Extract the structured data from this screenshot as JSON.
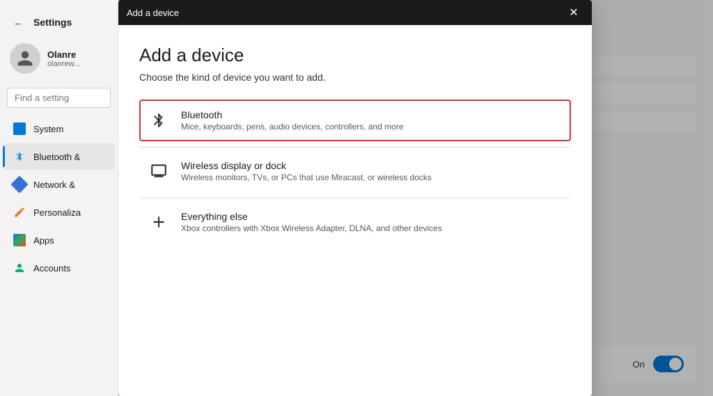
{
  "sidebar": {
    "back_label": "←",
    "title": "Settings",
    "user": {
      "name": "Olanre",
      "email": "olanrew..."
    },
    "search_placeholder": "Find a setting",
    "nav_items": [
      {
        "id": "system",
        "label": "System",
        "icon": "system-icon"
      },
      {
        "id": "bluetooth",
        "label": "Bluetooth &",
        "icon": "bluetooth-icon",
        "active": true
      },
      {
        "id": "network",
        "label": "Network &",
        "icon": "network-icon"
      },
      {
        "id": "personalization",
        "label": "Personaliza",
        "icon": "personalize-icon"
      },
      {
        "id": "apps",
        "label": "Apps",
        "icon": "apps-icon"
      },
      {
        "id": "accounts",
        "label": "Accounts",
        "icon": "accounts-icon"
      }
    ]
  },
  "background_panel": {
    "toggle_label": "On"
  },
  "modal": {
    "titlebar_title": "Add a device",
    "close_label": "✕",
    "heading": "Add a device",
    "subtitle": "Choose the kind of device you want to add.",
    "options": [
      {
        "id": "bluetooth",
        "title": "Bluetooth",
        "description": "Mice, keyboards, pens, audio devices, controllers, and more",
        "icon": "bluetooth-device-icon",
        "highlighted": true
      },
      {
        "id": "wireless",
        "title": "Wireless display or dock",
        "description": "Wireless monitors, TVs, or PCs that use Miracast, or wireless docks",
        "icon": "monitor-device-icon",
        "highlighted": false
      },
      {
        "id": "everything",
        "title": "Everything else",
        "description": "Xbox controllers with Xbox Wireless Adapter, DLNA, and other devices",
        "icon": "plus-device-icon",
        "highlighted": false
      }
    ]
  }
}
